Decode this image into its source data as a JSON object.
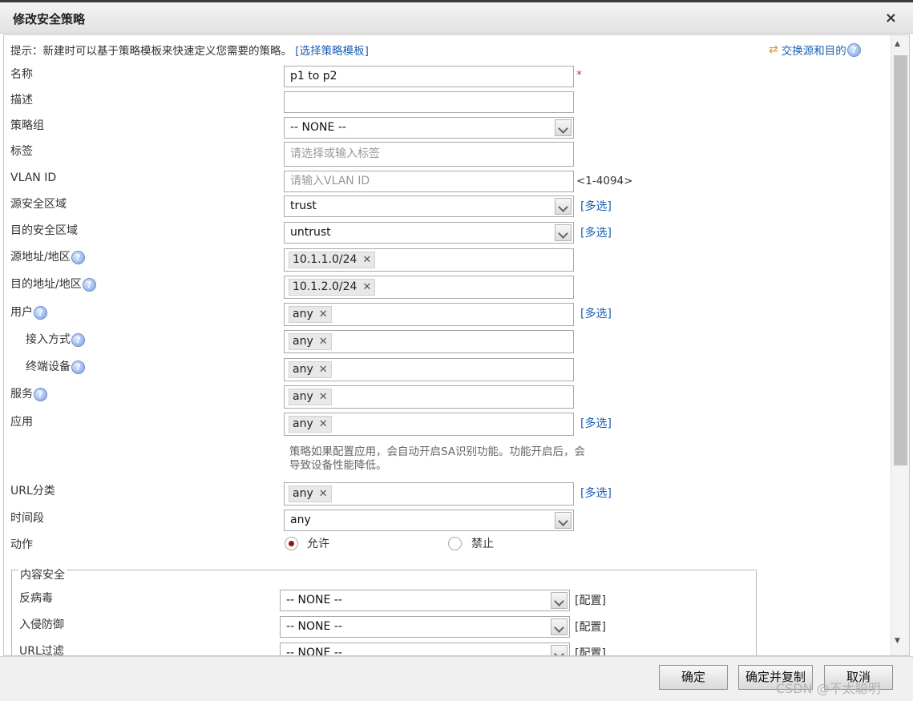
{
  "dialog": {
    "title": "修改安全策略",
    "close_glyph": "×"
  },
  "hint": {
    "text": "提示：新建时可以基于策略模板来快速定义您需要的策略。",
    "link": "[选择策略模板]"
  },
  "swap": {
    "label": "交换源和目的"
  },
  "help_glyph": "?",
  "required_mark": "*",
  "fields": {
    "name": {
      "label": "名称",
      "value": "p1 to p2"
    },
    "description": {
      "label": "描述",
      "value": ""
    },
    "policy_group": {
      "label": "策略组",
      "value": "-- NONE --"
    },
    "tag": {
      "label": "标签",
      "placeholder": "请选择或输入标签"
    },
    "vlan": {
      "label": "VLAN ID",
      "placeholder": "请输入VLAN ID",
      "range": "<1-4094>"
    },
    "src_zone": {
      "label": "源安全区域",
      "value": "trust",
      "multi": "[多选]"
    },
    "dst_zone": {
      "label": "目的安全区域",
      "value": "untrust",
      "multi": "[多选]"
    },
    "src_addr": {
      "label": "源地址/地区",
      "tag": "10.1.1.0/24"
    },
    "dst_addr": {
      "label": "目的地址/地区",
      "tag": "10.1.2.0/24"
    },
    "user": {
      "label": "用户",
      "tag": "any",
      "multi": "[多选]"
    },
    "access": {
      "label": "接入方式",
      "tag": "any"
    },
    "terminal": {
      "label": "终端设备",
      "tag": "any"
    },
    "service": {
      "label": "服务",
      "tag": "any"
    },
    "application": {
      "label": "应用",
      "tag": "any",
      "multi": "[多选]",
      "note": "策略如果配置应用，会自动开启SA识别功能。功能开启后，会导致设备性能降低。"
    },
    "url_category": {
      "label": "URL分类",
      "tag": "any",
      "multi": "[多选]"
    },
    "schedule": {
      "label": "时间段",
      "value": "any"
    },
    "action": {
      "label": "动作",
      "allow": "允许",
      "deny": "禁止",
      "selected": "允许"
    }
  },
  "tag_remove_glyph": "✕",
  "content_security": {
    "legend": "内容安全",
    "rows": [
      {
        "label": "反病毒",
        "value": "-- NONE --",
        "config": "[配置]"
      },
      {
        "label": "入侵防御",
        "value": "-- NONE --",
        "config": "[配置]"
      },
      {
        "label": "URL过滤",
        "value": "-- NONE --",
        "config": "[配置]"
      }
    ]
  },
  "footer": {
    "ok": "确定",
    "ok_copy": "确定并复制",
    "cancel": "取消"
  },
  "watermark": "CSDN @不太聪明",
  "colors": {
    "link": "#1a5fb4",
    "radio_selected": "#9b1010",
    "required": "#d33333"
  }
}
